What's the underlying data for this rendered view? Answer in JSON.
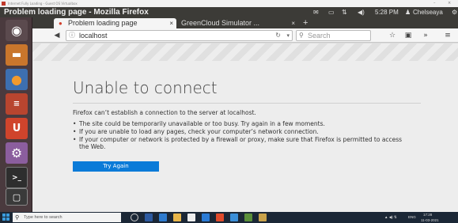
{
  "window_title": "Problem loading page - Mozilla Firefox",
  "host_window_title": "Internet Fully Loading - Guest OS Virtualbox",
  "tabs": [
    {
      "label": "Problem loading page",
      "active": true
    },
    {
      "label": "GreenCloud Simulator ...",
      "active": false
    }
  ],
  "new_tab_label": "+",
  "top_panel": {
    "time": "5:28 PM",
    "user": "Chelseaya"
  },
  "url": "localhost",
  "search_placeholder": "Search",
  "error": {
    "title": "Unable to connect",
    "description": "Firefox can’t establish a connection to the server at localhost.",
    "bullets": [
      "The site could be temporarily unavailable or too busy. Try again in a few moments.",
      "If you are unable to load any pages, check your computer’s network connection.",
      "If your computer or network is protected by a firewall or proxy, make sure that Firefox is permitted to access the Web."
    ],
    "button_label": "Try Again"
  },
  "taskbar": {
    "search_placeholder": "Type here to search",
    "tray_lang": "ENG",
    "time": "17:28",
    "date": "11-03-2021"
  },
  "colors": {
    "launcher_bg": "#4a3a3e",
    "panel_bg": "#3c3b37",
    "button_blue": "#0b7bd8",
    "taskbar_bg": "#1b2736"
  }
}
